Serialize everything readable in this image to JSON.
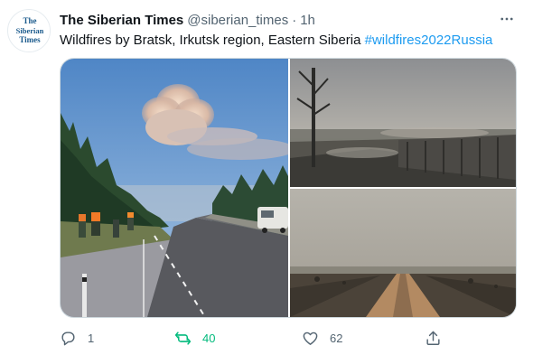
{
  "tweet": {
    "display_name": "The Siberian Times",
    "handle": "@siberian_times",
    "separator": "·",
    "time": "1h",
    "more_icon": "more-horizontal-icon",
    "text": "Wildfires by Bratsk, Irkutsk region, Eastern Siberia ",
    "hashtag": "#wildfires2022Russia",
    "avatar_text": [
      "The",
      "Siberian",
      "Times"
    ]
  },
  "actions": {
    "reply_count": "1",
    "retweet_count": "40",
    "like_count": "62"
  },
  "colors": {
    "accent": "#1d9bf0",
    "retweet_active": "#00ba7c",
    "secondary_text": "#536471",
    "brand_avatar": "#1a5a8c"
  }
}
